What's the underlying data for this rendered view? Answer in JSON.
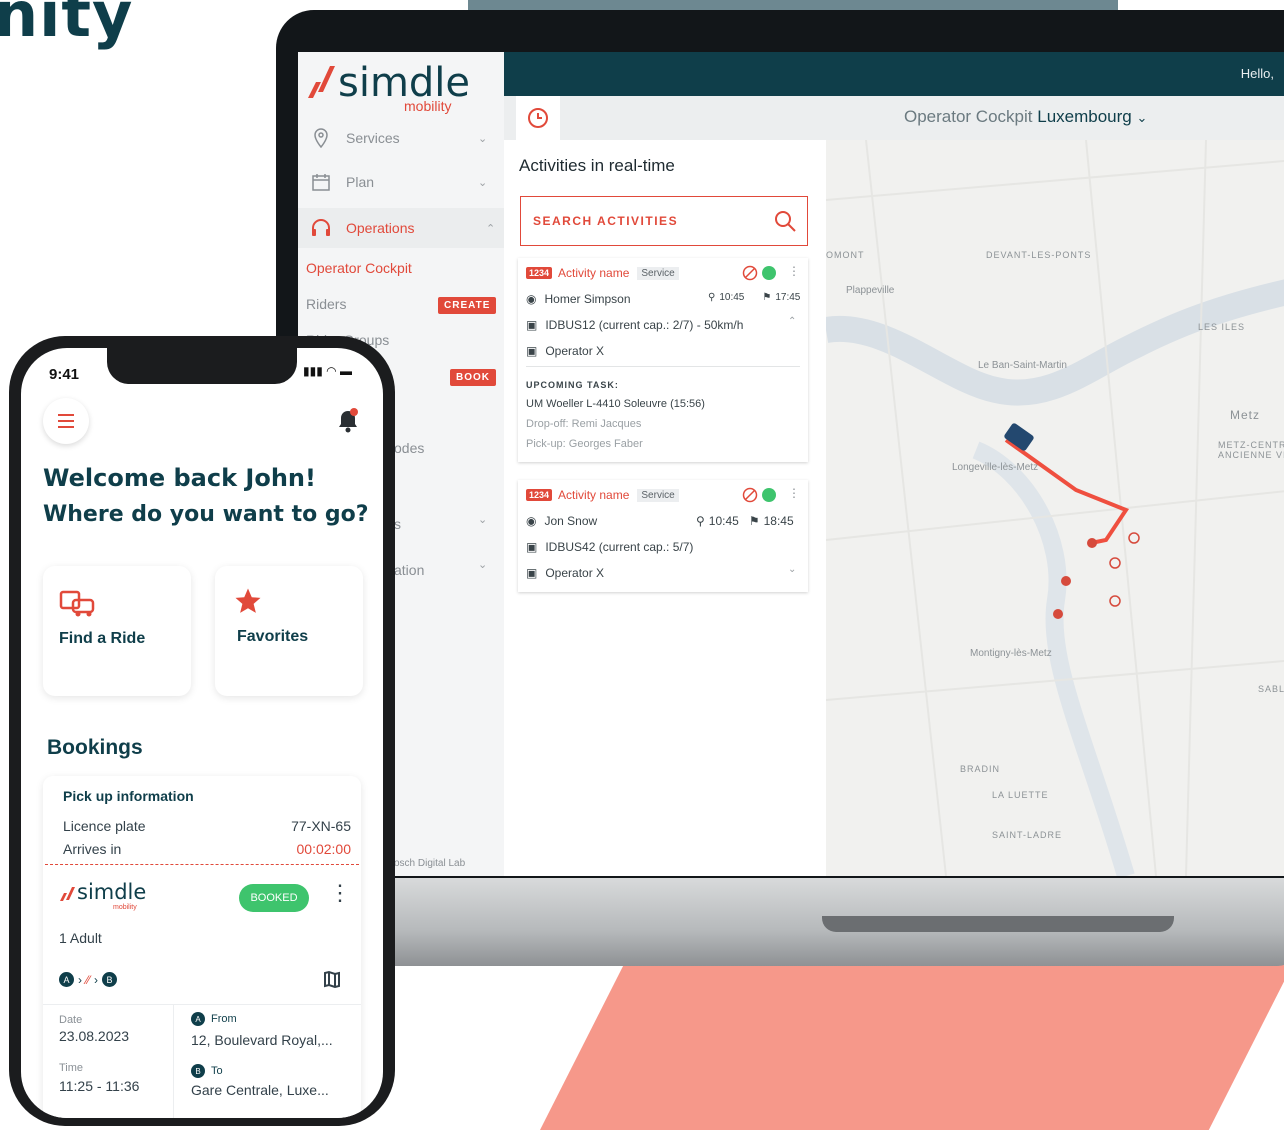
{
  "headline": "nity",
  "laptop": {
    "logo": {
      "brand": "simdle",
      "sub": "mobility"
    },
    "sidebar": [
      {
        "label": "Services",
        "icon": "map-pin-icon",
        "chevron": "⌄"
      },
      {
        "label": "Plan",
        "icon": "calendar-icon",
        "chevron": "⌄"
      },
      {
        "label": "Operations",
        "icon": "headset-icon",
        "chevron": "⌃"
      }
    ],
    "sub_items": {
      "operator_cockpit": "Operator Cockpit",
      "riders": "Riders",
      "rider_groups": "Rider Groups",
      "codes": "odes",
      "sec1": "s",
      "sec2": "ation",
      "footer": "osch Digital Lab"
    },
    "pills": {
      "create": "CREATE",
      "book": "BOOK"
    },
    "header": {
      "hello": "Hello,"
    },
    "titlebar": {
      "prefix": "Operator Cockpit",
      "city": "Luxembourg"
    },
    "panel": {
      "title": "Activities in real-time",
      "search_placeholder": "SEARCH ACTIVITIES",
      "cards": [
        {
          "id": "1234",
          "name": "Activity name",
          "service": "Service",
          "rider": "Homer Simpson",
          "start": "10:45",
          "end": "17:45",
          "vehicle": "IDBUS12 (current cap.: 2/7) - 50km/h",
          "operator": "Operator X",
          "upcoming_label": "UPCOMING TASK:",
          "upcoming_task": "UM Woeller L-4410 Soleuvre (15:56)",
          "dropoff": "Drop-off: Remi Jacques",
          "pickup": "Pick-up: Georges Faber"
        },
        {
          "id": "1234",
          "name": "Activity name",
          "service": "Service",
          "rider": "Jon Snow",
          "start": "10:45",
          "end": "18:45",
          "vehicle": "IDBUS42 (current cap.: 5/7)",
          "operator": "Operator X"
        }
      ]
    },
    "map_labels": {
      "devant": "DEVANT-LES-PONTS",
      "plappeville": "Plappeville",
      "ban": "Le Ban-Saint-Martin",
      "longeville": "Longeville-lès-Metz",
      "metz": "Metz",
      "metz_centre": "METZ-CENTRE",
      "ancienne": "ANCIENNE VI",
      "les_iles": "LES ILES",
      "montigny": "Montigny-lès-Metz",
      "bradin": "BRADIN",
      "luette": "LA LUETTE",
      "ladre": "SAINT-LADRE",
      "sablo": "SABLO",
      "omont": "OMONT"
    }
  },
  "phone": {
    "time": "9:41",
    "welcome": "Welcome back John!",
    "where": "Where do you want to go?",
    "actions": [
      {
        "label": "Find a Ride",
        "icon": "car-icon"
      },
      {
        "label": "Favorites",
        "icon": "star-icon"
      }
    ],
    "bookings_title": "Bookings",
    "booking": {
      "pickup_info": "Pick up information",
      "plate_label": "Licence plate",
      "plate": "77-XN-65",
      "arrives_label": "Arrives in",
      "arrives": "00:02:00",
      "brand": "simdle",
      "brand_sub": "mobility",
      "status": "BOOKED",
      "passengers": "1 Adult",
      "date_label": "Date",
      "date": "23.08.2023",
      "time_label": "Time",
      "time": "11:25 - 11:36",
      "from_label": "From",
      "from": "12, Boulevard Royal,...",
      "to_label": "To",
      "to": "Gare Centrale, Luxe...",
      "point_a": "A",
      "point_b": "B"
    }
  },
  "colors": {
    "brand_red": "#e1493a",
    "brand_dark": "#0f3e4a",
    "status_green": "#3ec46d",
    "route": "#ef4f3f"
  }
}
